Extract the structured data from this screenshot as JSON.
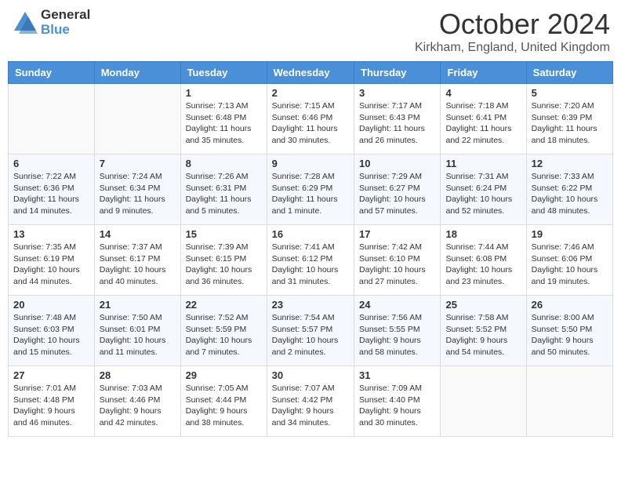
{
  "header": {
    "logo_general": "General",
    "logo_blue": "Blue",
    "month_title": "October 2024",
    "location": "Kirkham, England, United Kingdom"
  },
  "days_of_week": [
    "Sunday",
    "Monday",
    "Tuesday",
    "Wednesday",
    "Thursday",
    "Friday",
    "Saturday"
  ],
  "weeks": [
    [
      {
        "day": "",
        "sunrise": "",
        "sunset": "",
        "daylight": ""
      },
      {
        "day": "",
        "sunrise": "",
        "sunset": "",
        "daylight": ""
      },
      {
        "day": "1",
        "sunrise": "Sunrise: 7:13 AM",
        "sunset": "Sunset: 6:48 PM",
        "daylight": "Daylight: 11 hours and 35 minutes."
      },
      {
        "day": "2",
        "sunrise": "Sunrise: 7:15 AM",
        "sunset": "Sunset: 6:46 PM",
        "daylight": "Daylight: 11 hours and 30 minutes."
      },
      {
        "day": "3",
        "sunrise": "Sunrise: 7:17 AM",
        "sunset": "Sunset: 6:43 PM",
        "daylight": "Daylight: 11 hours and 26 minutes."
      },
      {
        "day": "4",
        "sunrise": "Sunrise: 7:18 AM",
        "sunset": "Sunset: 6:41 PM",
        "daylight": "Daylight: 11 hours and 22 minutes."
      },
      {
        "day": "5",
        "sunrise": "Sunrise: 7:20 AM",
        "sunset": "Sunset: 6:39 PM",
        "daylight": "Daylight: 11 hours and 18 minutes."
      }
    ],
    [
      {
        "day": "6",
        "sunrise": "Sunrise: 7:22 AM",
        "sunset": "Sunset: 6:36 PM",
        "daylight": "Daylight: 11 hours and 14 minutes."
      },
      {
        "day": "7",
        "sunrise": "Sunrise: 7:24 AM",
        "sunset": "Sunset: 6:34 PM",
        "daylight": "Daylight: 11 hours and 9 minutes."
      },
      {
        "day": "8",
        "sunrise": "Sunrise: 7:26 AM",
        "sunset": "Sunset: 6:31 PM",
        "daylight": "Daylight: 11 hours and 5 minutes."
      },
      {
        "day": "9",
        "sunrise": "Sunrise: 7:28 AM",
        "sunset": "Sunset: 6:29 PM",
        "daylight": "Daylight: 11 hours and 1 minute."
      },
      {
        "day": "10",
        "sunrise": "Sunrise: 7:29 AM",
        "sunset": "Sunset: 6:27 PM",
        "daylight": "Daylight: 10 hours and 57 minutes."
      },
      {
        "day": "11",
        "sunrise": "Sunrise: 7:31 AM",
        "sunset": "Sunset: 6:24 PM",
        "daylight": "Daylight: 10 hours and 52 minutes."
      },
      {
        "day": "12",
        "sunrise": "Sunrise: 7:33 AM",
        "sunset": "Sunset: 6:22 PM",
        "daylight": "Daylight: 10 hours and 48 minutes."
      }
    ],
    [
      {
        "day": "13",
        "sunrise": "Sunrise: 7:35 AM",
        "sunset": "Sunset: 6:19 PM",
        "daylight": "Daylight: 10 hours and 44 minutes."
      },
      {
        "day": "14",
        "sunrise": "Sunrise: 7:37 AM",
        "sunset": "Sunset: 6:17 PM",
        "daylight": "Daylight: 10 hours and 40 minutes."
      },
      {
        "day": "15",
        "sunrise": "Sunrise: 7:39 AM",
        "sunset": "Sunset: 6:15 PM",
        "daylight": "Daylight: 10 hours and 36 minutes."
      },
      {
        "day": "16",
        "sunrise": "Sunrise: 7:41 AM",
        "sunset": "Sunset: 6:12 PM",
        "daylight": "Daylight: 10 hours and 31 minutes."
      },
      {
        "day": "17",
        "sunrise": "Sunrise: 7:42 AM",
        "sunset": "Sunset: 6:10 PM",
        "daylight": "Daylight: 10 hours and 27 minutes."
      },
      {
        "day": "18",
        "sunrise": "Sunrise: 7:44 AM",
        "sunset": "Sunset: 6:08 PM",
        "daylight": "Daylight: 10 hours and 23 minutes."
      },
      {
        "day": "19",
        "sunrise": "Sunrise: 7:46 AM",
        "sunset": "Sunset: 6:06 PM",
        "daylight": "Daylight: 10 hours and 19 minutes."
      }
    ],
    [
      {
        "day": "20",
        "sunrise": "Sunrise: 7:48 AM",
        "sunset": "Sunset: 6:03 PM",
        "daylight": "Daylight: 10 hours and 15 minutes."
      },
      {
        "day": "21",
        "sunrise": "Sunrise: 7:50 AM",
        "sunset": "Sunset: 6:01 PM",
        "daylight": "Daylight: 10 hours and 11 minutes."
      },
      {
        "day": "22",
        "sunrise": "Sunrise: 7:52 AM",
        "sunset": "Sunset: 5:59 PM",
        "daylight": "Daylight: 10 hours and 7 minutes."
      },
      {
        "day": "23",
        "sunrise": "Sunrise: 7:54 AM",
        "sunset": "Sunset: 5:57 PM",
        "daylight": "Daylight: 10 hours and 2 minutes."
      },
      {
        "day": "24",
        "sunrise": "Sunrise: 7:56 AM",
        "sunset": "Sunset: 5:55 PM",
        "daylight": "Daylight: 9 hours and 58 minutes."
      },
      {
        "day": "25",
        "sunrise": "Sunrise: 7:58 AM",
        "sunset": "Sunset: 5:52 PM",
        "daylight": "Daylight: 9 hours and 54 minutes."
      },
      {
        "day": "26",
        "sunrise": "Sunrise: 8:00 AM",
        "sunset": "Sunset: 5:50 PM",
        "daylight": "Daylight: 9 hours and 50 minutes."
      }
    ],
    [
      {
        "day": "27",
        "sunrise": "Sunrise: 7:01 AM",
        "sunset": "Sunset: 4:48 PM",
        "daylight": "Daylight: 9 hours and 46 minutes."
      },
      {
        "day": "28",
        "sunrise": "Sunrise: 7:03 AM",
        "sunset": "Sunset: 4:46 PM",
        "daylight": "Daylight: 9 hours and 42 minutes."
      },
      {
        "day": "29",
        "sunrise": "Sunrise: 7:05 AM",
        "sunset": "Sunset: 4:44 PM",
        "daylight": "Daylight: 9 hours and 38 minutes."
      },
      {
        "day": "30",
        "sunrise": "Sunrise: 7:07 AM",
        "sunset": "Sunset: 4:42 PM",
        "daylight": "Daylight: 9 hours and 34 minutes."
      },
      {
        "day": "31",
        "sunrise": "Sunrise: 7:09 AM",
        "sunset": "Sunset: 4:40 PM",
        "daylight": "Daylight: 9 hours and 30 minutes."
      },
      {
        "day": "",
        "sunrise": "",
        "sunset": "",
        "daylight": ""
      },
      {
        "day": "",
        "sunrise": "",
        "sunset": "",
        "daylight": ""
      }
    ]
  ]
}
